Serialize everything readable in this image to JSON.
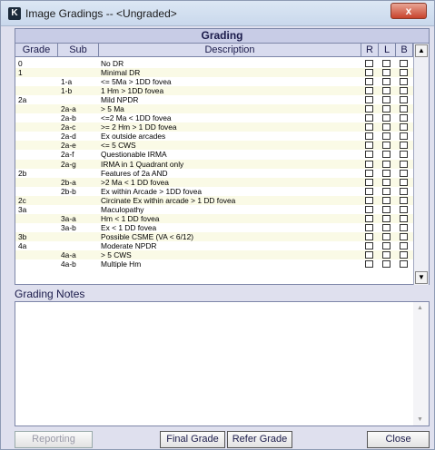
{
  "window": {
    "title": "Image Gradings -- <Ungraded>",
    "app_icon_letter": "K",
    "close_glyph": "x"
  },
  "grading": {
    "header": "Grading",
    "columns": {
      "grade": "Grade",
      "sub": "Sub",
      "description": "Description",
      "r": "R",
      "l": "L",
      "b": "B"
    },
    "rows": [
      {
        "grade": "0",
        "sub": "",
        "desc": "No DR"
      },
      {
        "grade": "1",
        "sub": "",
        "desc": "Minimal DR"
      },
      {
        "grade": "",
        "sub": "1-a",
        "desc": "<= 5Ma > 1DD fovea"
      },
      {
        "grade": "",
        "sub": "1-b",
        "desc": "1 Hm > 1DD fovea"
      },
      {
        "grade": "2a",
        "sub": "",
        "desc": "Mild NPDR"
      },
      {
        "grade": "",
        "sub": "2a-a",
        "desc": "> 5 Ma"
      },
      {
        "grade": "",
        "sub": "2a-b",
        "desc": "<=2 Ma < 1DD fovea"
      },
      {
        "grade": "",
        "sub": "2a-c",
        "desc": ">= 2 Hm > 1 DD fovea"
      },
      {
        "grade": "",
        "sub": "2a-d",
        "desc": "Ex outside arcades"
      },
      {
        "grade": "",
        "sub": "2a-e",
        "desc": "<= 5 CWS"
      },
      {
        "grade": "",
        "sub": "2a-f",
        "desc": "Questionable IRMA"
      },
      {
        "grade": "",
        "sub": "2a-g",
        "desc": "IRMA in 1 Quadrant only"
      },
      {
        "grade": "2b",
        "sub": "",
        "desc": "Features of 2a AND"
      },
      {
        "grade": "",
        "sub": "2b-a",
        "desc": ">2 Ma < 1 DD fovea"
      },
      {
        "grade": "",
        "sub": "2b-b",
        "desc": "Ex within Arcade > 1DD fovea"
      },
      {
        "grade": "2c",
        "sub": "",
        "desc": "Circinate Ex within arcade > 1 DD fovea"
      },
      {
        "grade": "3a",
        "sub": "",
        "desc": "Maculopathy"
      },
      {
        "grade": "",
        "sub": "3a-a",
        "desc": "Hm < 1 DD fovea"
      },
      {
        "grade": "",
        "sub": "3a-b",
        "desc": "Ex < 1 DD fovea"
      },
      {
        "grade": "3b",
        "sub": "",
        "desc": "Possible CSME (VA < 6/12)"
      },
      {
        "grade": "4a",
        "sub": "",
        "desc": "Moderate NPDR"
      },
      {
        "grade": "",
        "sub": "4a-a",
        "desc": "> 5 CWS"
      },
      {
        "grade": "",
        "sub": "4a-b",
        "desc": "Multiple Hm"
      }
    ]
  },
  "notes": {
    "label": "Grading Notes",
    "value": ""
  },
  "buttons": {
    "reporting": "Reporting",
    "final_grade": "Final Grade",
    "refer_grade": "Refer Grade",
    "close": "Close"
  },
  "icons": {
    "scroll_up": "▲",
    "scroll_down": "▼"
  }
}
